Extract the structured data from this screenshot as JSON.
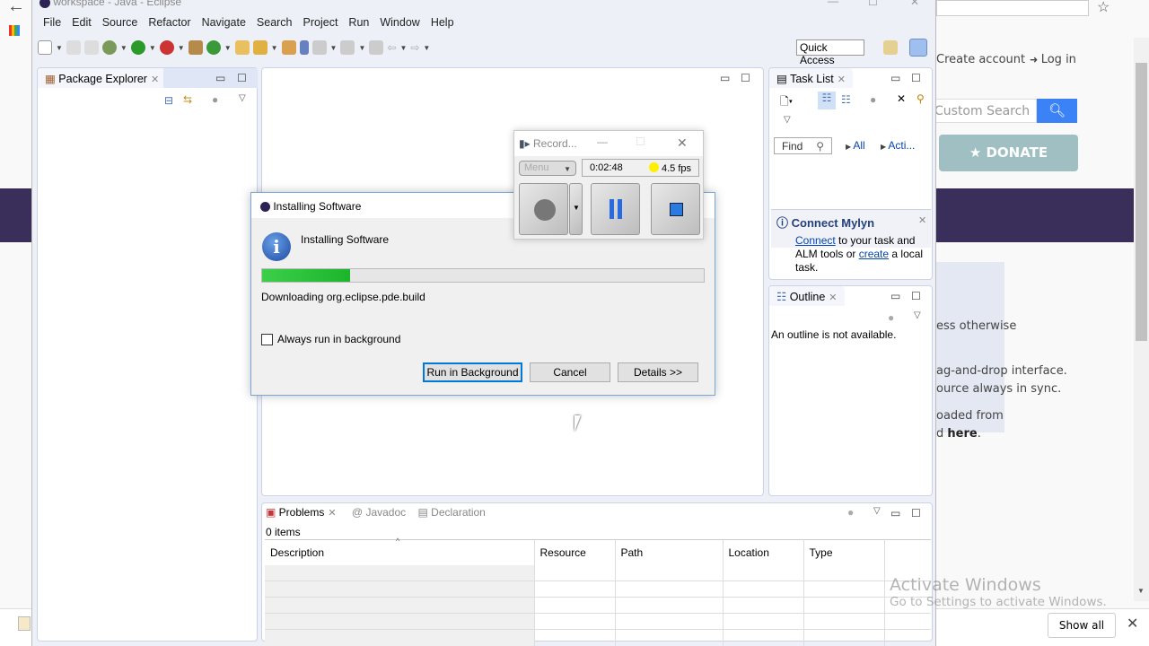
{
  "browser": {
    "create_account": "Create account",
    "log_in": "Log in",
    "search_placeholder": "Custom Search",
    "donate": "DONATE",
    "text_lines": [
      "ess otherwise",
      "ag-and-drop interface.",
      "ource always in sync.",
      "oaded from"
    ],
    "here_prefix": "d ",
    "here": "here",
    "here_suffix": ".",
    "show_all": "Show all"
  },
  "eclipse": {
    "title": "workspace - Java - Eclipse",
    "menu": [
      "File",
      "Edit",
      "Source",
      "Refactor",
      "Navigate",
      "Search",
      "Project",
      "Run",
      "Window",
      "Help"
    ],
    "quick_access": "Quick Access",
    "package_explorer": "Package Explorer",
    "task_list": {
      "title": "Task List",
      "find": "Find",
      "all": "All",
      "activate": "Acti..."
    },
    "mylyn": {
      "title": "Connect Mylyn",
      "connect": "Connect",
      "text1": " to your task and",
      "text2": "ALM tools or ",
      "create": "create",
      "text3": " a local",
      "text4": "task."
    },
    "outline": {
      "title": "Outline",
      "message": "An outline is not available."
    },
    "problems": {
      "tabs": [
        "Problems",
        "Javadoc",
        "Declaration"
      ],
      "count": "0 items",
      "columns": [
        "Description",
        "Resource",
        "Path",
        "Location",
        "Type"
      ]
    }
  },
  "dialog": {
    "title": "Installing Software",
    "heading": "Installing Software",
    "progress": 0.2,
    "status": "Downloading org.eclipse.pde.build",
    "checkbox_label": "Always run in background",
    "checkbox_checked": false,
    "buttons": {
      "background": "Run in Background",
      "cancel": "Cancel",
      "details": "Details >>"
    }
  },
  "recorder": {
    "title": "Record...",
    "menu": "Menu",
    "time": "0:02:48",
    "fps": "4.5 fps"
  },
  "watermark": {
    "title": "Activate Windows",
    "subtitle": "Go to Settings to activate Windows."
  },
  "colors": {
    "accent": "#3b82f6",
    "donate": "#9fbfc3",
    "progress": "#2bc53b"
  }
}
